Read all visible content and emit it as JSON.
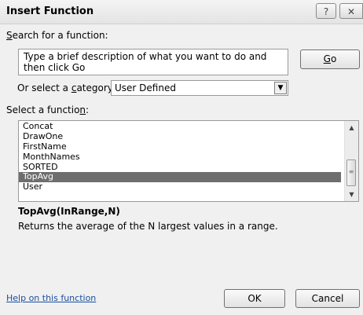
{
  "window": {
    "title": "Insert Function",
    "help_glyph": "?",
    "close_glyph": "✕"
  },
  "search": {
    "label_accesskey": "S",
    "label_rest": "earch for a function:",
    "value": "Type a brief description of what you want to do and then click Go",
    "go_accesskey": "G",
    "go_rest": "o"
  },
  "category": {
    "label_pre": "Or select a ",
    "label_accesskey": "c",
    "label_post": "ategory:",
    "selected": "User Defined"
  },
  "functions": {
    "label_pre": "Select a functio",
    "label_accesskey": "n",
    "label_post": ":",
    "items": [
      "Concat",
      "DrawOne",
      "FirstName",
      "MonthNames",
      "SORTED",
      "TopAvg",
      "User"
    ],
    "selected": "TopAvg"
  },
  "details": {
    "signature": "TopAvg(InRange,N)",
    "description": "Returns the average of the N largest values in a range."
  },
  "footer": {
    "help_link": "Help on this function",
    "ok_label": "OK",
    "cancel_label": "Cancel"
  }
}
